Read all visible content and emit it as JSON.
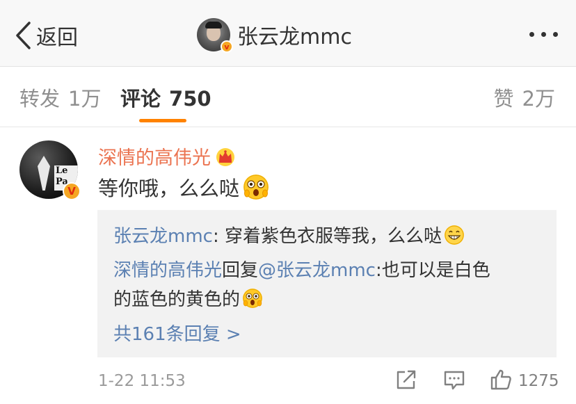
{
  "navbar": {
    "back_label": "返回",
    "title": "张云龙mmc"
  },
  "tabs": {
    "repost": {
      "label": "转发",
      "count": "1万"
    },
    "comment": {
      "label": "评论",
      "count": "750"
    },
    "like": {
      "label": "赞",
      "count": "2万"
    }
  },
  "comment": {
    "author": "深情的高伟光",
    "text": "等你哦，么么哒",
    "avatar_poster_text": "Le Pa",
    "time": "1-22 11:53",
    "like_count": "1275",
    "replies": {
      "reply1_author": "张云龙mmc",
      "reply1_text": ": 穿着紫色衣服等我，么么哒",
      "reply2_author": "深情的高伟光",
      "reply2_verb": "回复",
      "reply2_mention": "@张云龙mmc",
      "reply2_text_a": ":也可以是白色",
      "reply2_text_b": "的蓝色的黄色的",
      "more_link": "共161条回复 >"
    }
  },
  "colors": {
    "accent": "#ff8200",
    "author_name": "#eb7350",
    "link": "#5b80b2",
    "verified_badge": "#f5a623"
  },
  "icons": {
    "back": "chevron-left-icon",
    "more": "more-dots-icon",
    "share": "share-icon",
    "comment": "comment-icon",
    "like": "thumbs-up-icon",
    "crown": "crown-icon"
  }
}
